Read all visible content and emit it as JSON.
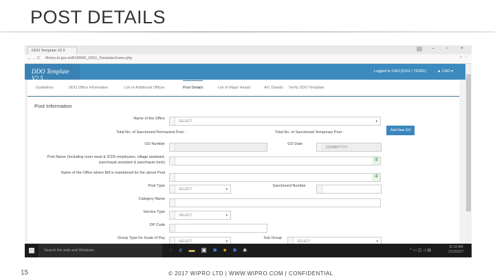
{
  "slide": {
    "title": "POST DETAILS",
    "page_number": "15",
    "footer": "© 2017 WIPRO LTD | WWW.WIPRO.COM | CONFIDENTIAL"
  },
  "browser": {
    "tab_title": "DDO Template V2.5",
    "url": "ifhrms.tn.gov.in/IFHRMS_DDO_Template/home.php"
  },
  "app": {
    "brand": "DDO Template V2.5",
    "login_info": "Logged in CAO [0101 / TG301]",
    "user": "CAO"
  },
  "nav": [
    "Guidelines",
    "DDO Office Information",
    "List of Additional Offices",
    "Post Details",
    "List of Major Heads",
    "A/C Details",
    "Verify DDO Template"
  ],
  "panel_title": "Post Information",
  "form": {
    "office_label": "Name of the Office",
    "office_value": "SELECT",
    "perm_label": "Total No. of Sanctioned Permanent Post :",
    "temp_label": "Total No. of Sanctioned Temporary Post :",
    "add_go": "Add New GO",
    "go_number_label": "GO Number",
    "go_date_label": "GO Date",
    "go_date_placeholder": "DD/MM/YYYY",
    "post_name_label": "Post Name (Including noon meal & ICDS employees, village assistant, panchayat assistant & panchayat clerk)",
    "bill_office_label": "Name of the Office where Bill is maintained for the above Post",
    "post_type_label": "Post Type",
    "post_type_value": "SELECT",
    "sanctioned_label": "Sanctioned Number",
    "category_label": "Category Name",
    "service_label": "Service Type",
    "service_value": "SELECT",
    "dp_label": "DP Code",
    "group_label": "Group Type for Scale of Pay",
    "group_value": "SELECT",
    "subgroup_label": "Sub Group",
    "subgroup_value": "SELECT"
  },
  "taskbar": {
    "search": "Search the web and Windows",
    "time": "11:10 AM",
    "date": "1/12/2017"
  }
}
